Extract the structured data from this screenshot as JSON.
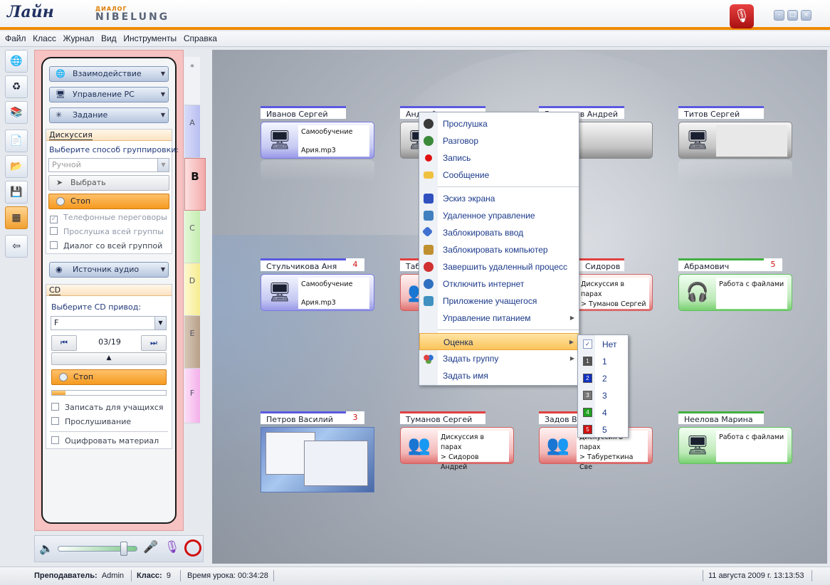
{
  "app": {
    "logo": "Лайн",
    "brand_small": "ДИАЛОГ",
    "brand": "NIBELUNG"
  },
  "menu": [
    "Файл",
    "Класс",
    "Журнал",
    "Вид",
    "Инструменты",
    "Справка"
  ],
  "panel": {
    "buttons": [
      {
        "label": "Взаимодействие",
        "icon": "interaction-icon"
      },
      {
        "label": "Управление PC",
        "icon": "pc-control-icon"
      },
      {
        "label": "Задание",
        "icon": "task-icon"
      }
    ],
    "discussion": {
      "title": "Дискуссия",
      "group_label": "Выберите способ группировки:",
      "group_value": "Ручной",
      "select_label": "Выбрать",
      "stop_label": "Стоп",
      "checks": [
        {
          "label": "Телефонные переговоры",
          "checked": true,
          "disabled": true
        },
        {
          "label": "Прослушка всей группы",
          "checked": false,
          "disabled": true
        },
        {
          "label": "Диалог со всей группой",
          "checked": false,
          "disabled": false
        }
      ]
    },
    "audio_source_label": "Источник аудио",
    "cd": {
      "title": "CD",
      "drive_label": "Выберите CD привод:",
      "drive_value": "F",
      "track": "03/19",
      "stop_label": "Стоп",
      "checks": [
        "Записать для учащихся",
        "Прослушивание",
        "Оцифровать материал"
      ]
    }
  },
  "tabs": [
    "*",
    "A",
    "B",
    "C",
    "D",
    "E",
    "F"
  ],
  "students": [
    {
      "name": "Иванов Сергей",
      "num": "",
      "color": "blue",
      "line1": "Самообучение",
      "line2": "Ария.mp3"
    },
    {
      "name": "Андрейченко Ирина",
      "num": "",
      "color": "gray",
      "line1": "",
      "line2": ""
    },
    {
      "name": "Виденеев Андрей",
      "num": "",
      "color": "gray",
      "line1": "",
      "line2": ""
    },
    {
      "name": "Титов Сергей",
      "num": "",
      "color": "gray",
      "line1": "",
      "line2": ""
    },
    {
      "name": "Стульчикова Аня",
      "num": "4",
      "color": "blue",
      "line1": "Самообучение",
      "line2": "Ария.mp3"
    },
    {
      "name": "Табуреткина Света",
      "num": "",
      "color": "red",
      "line1": "",
      "line2": ""
    },
    {
      "name": "Сидоров Андрей",
      "num": "",
      "color": "red",
      "line1": "Дискуссия в парах",
      "line2": "> Туманов Сергей"
    },
    {
      "name": "Абрамович Геннадий",
      "num": "5",
      "color": "green",
      "line1": "Работа с файлами",
      "line2": ""
    },
    {
      "name": "Петров Василий",
      "num": "3",
      "color": "blue",
      "line1": "",
      "line2": ""
    },
    {
      "name": "Туманов Сергей",
      "num": "",
      "color": "red",
      "line1": "Дискуссия в парах",
      "line2": "> Сидоров Андрей"
    },
    {
      "name": "Задов Василий",
      "num": "",
      "color": "red",
      "line1": "Дискуссия в парах",
      "line2": "> Табуреткина Све"
    },
    {
      "name": "Неелова Марина",
      "num": "",
      "color": "green",
      "line1": "Работа с файлами",
      "line2": ""
    }
  ],
  "context_menu": [
    {
      "label": "Прослушка",
      "icon": "headphones-icon",
      "color": "#3a3a3a"
    },
    {
      "label": "Разговор",
      "icon": "talk-icon",
      "color": "#3a8a3a"
    },
    {
      "label": "Запись",
      "icon": "record-icon",
      "color": "#e01010"
    },
    {
      "label": "Сообщение",
      "icon": "message-icon",
      "color": "#f0c040"
    },
    {
      "label": "Эскиз экрана",
      "icon": "monitor-icon",
      "color": "#3050c0"
    },
    {
      "label": "Удаленное управление",
      "icon": "remote-icon",
      "color": "#4080c0"
    },
    {
      "label": "Заблокировать ввод",
      "icon": "lock-input-icon",
      "color": "#4070d0"
    },
    {
      "label": "Заблокировать компьютер",
      "icon": "lock-icon",
      "color": "#c09030"
    },
    {
      "label": "Завершить удаленный процесс",
      "icon": "kill-process-icon",
      "color": "#d03030"
    },
    {
      "label": "Отключить интернет",
      "icon": "internet-off-icon",
      "color": "#3070c0"
    },
    {
      "label": "Приложение учащегося",
      "icon": "app-icon",
      "color": "#4090c0"
    },
    {
      "label": "Управление питанием",
      "icon": "power-icon",
      "color": "",
      "submenu": true
    },
    {
      "label": "Оценка",
      "icon": "",
      "color": "",
      "submenu": true,
      "highlight": true
    },
    {
      "label": "Задать группу",
      "icon": "group-icon",
      "color": "#60a040",
      "submenu": true
    },
    {
      "label": "Задать имя",
      "icon": "",
      "color": ""
    }
  ],
  "grade_menu": [
    {
      "label": "Нет",
      "color": "#ffffff",
      "digit": "✓"
    },
    {
      "label": "1",
      "color": "#555555",
      "digit": "1"
    },
    {
      "label": "2",
      "color": "#1030c0",
      "digit": "2"
    },
    {
      "label": "3",
      "color": "#777777",
      "digit": "3"
    },
    {
      "label": "4",
      "color": "#20a020",
      "digit": "4"
    },
    {
      "label": "5",
      "color": "#d01010",
      "digit": "5"
    }
  ],
  "status": {
    "teacher_label": "Преподаватель:",
    "teacher": "Admin",
    "class_label": "Класс:",
    "class": "9",
    "lesson_time": "Время урока: 00:34:28",
    "datetime": "11 августа 2009 г. 13:13:53"
  }
}
